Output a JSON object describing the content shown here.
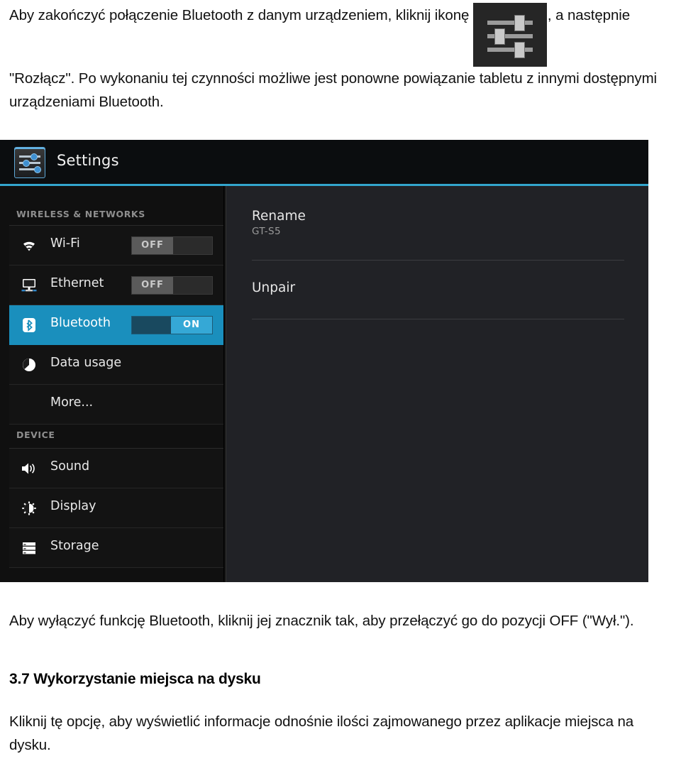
{
  "document": {
    "intro_paragraph_part1": "Aby zakończyć połączenie Bluetooth z danym urządzeniem, kliknij ikonę",
    "intro_icon_name": "settings-sliders-icon",
    "intro_paragraph_part2": ", a następnie \"Rozłącz\". Po wykonaniu tej czynności możliwe jest ponowne powiązanie tabletu z innymi dostępnymi urządzeniami Bluetooth.",
    "after_paragraph": "Aby wyłączyć funkcję Bluetooth, kliknij jej znacznik tak, aby przełączyć go do pozycji OFF (\"Wył.\").",
    "section_heading": "3.7 Wykorzystanie miejsca na dysku",
    "closing_paragraph": "Kliknij tę opcję, aby wyświetlić informacje odnośnie ilości zajmowanego przez aplikacje miejsca na dysku."
  },
  "screenshot": {
    "action_bar": {
      "title": "Settings",
      "app_icon": "settings-sliders-icon"
    },
    "accent_color": "#33a5cd",
    "selected_color": "#1a8fbd",
    "sections": [
      {
        "header": "WIRELESS & NETWORKS",
        "rows": [
          {
            "label": "Wi-Fi",
            "icon": "wifi-icon",
            "toggle": "OFF",
            "toggle_state": "off",
            "selected": false
          },
          {
            "label": "Ethernet",
            "icon": "ethernet-icon",
            "toggle": "OFF",
            "toggle_state": "off",
            "selected": false
          },
          {
            "label": "Bluetooth",
            "icon": "bluetooth-icon",
            "toggle": "ON",
            "toggle_state": "on",
            "selected": true
          },
          {
            "label": "Data usage",
            "icon": "data-usage-icon",
            "toggle": null,
            "selected": false
          },
          {
            "label": "More...",
            "icon": null,
            "toggle": null,
            "selected": false
          }
        ]
      },
      {
        "header": "DEVICE",
        "rows": [
          {
            "label": "Sound",
            "icon": "sound-icon",
            "toggle": null,
            "selected": false
          },
          {
            "label": "Display",
            "icon": "display-icon",
            "toggle": null,
            "selected": false
          },
          {
            "label": "Storage",
            "icon": "storage-icon",
            "toggle": null,
            "selected": false
          }
        ]
      }
    ],
    "detail_panel": {
      "items": [
        {
          "title": "Rename",
          "subtitle": "GT-S5"
        },
        {
          "title": "Unpair",
          "subtitle": null
        }
      ]
    }
  }
}
